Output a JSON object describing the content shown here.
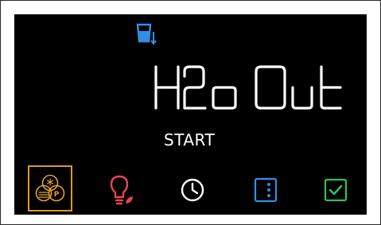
{
  "display": {
    "status_text": "H2o Out",
    "start_label": "START"
  },
  "icons": {
    "water": "water-out-icon",
    "combo": "ice-water-p-icon",
    "light": "eco-bulb-icon",
    "clock": "clock-icon",
    "menu": "menu-dots-icon",
    "check": "checkbox-icon"
  },
  "colors": {
    "background": "#000000",
    "amber": "#e2a235",
    "red": "#e8454f",
    "green": "#32c058",
    "blue": "#2f8fe6",
    "white": "#ffffff"
  }
}
